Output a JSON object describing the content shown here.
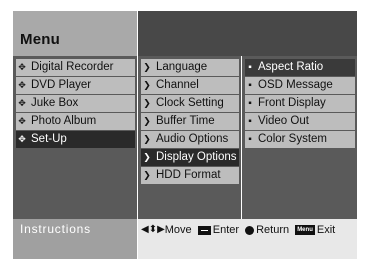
{
  "header": {
    "title": "Menu"
  },
  "columns": {
    "main": [
      {
        "label": "Digital Recorder",
        "selected": false
      },
      {
        "label": "DVD Player",
        "selected": false
      },
      {
        "label": "Juke Box",
        "selected": false
      },
      {
        "label": "Photo Album",
        "selected": false
      },
      {
        "label": "Set-Up",
        "selected": true
      }
    ],
    "setup": [
      {
        "label": "Language",
        "selected": false
      },
      {
        "label": "Channel",
        "selected": false
      },
      {
        "label": "Clock Setting",
        "selected": false
      },
      {
        "label": "Buffer Time",
        "selected": false
      },
      {
        "label": "Audio Options",
        "selected": false
      },
      {
        "label": "Display Options",
        "selected": true
      },
      {
        "label": "HDD Format",
        "selected": false
      }
    ],
    "display": [
      {
        "label": "Aspect Ratio",
        "selected": true
      },
      {
        "label": "OSD Message",
        "selected": false
      },
      {
        "label": "Front Display",
        "selected": false
      },
      {
        "label": "Video Out",
        "selected": false
      },
      {
        "label": "Color System",
        "selected": false
      }
    ]
  },
  "footer": {
    "instructions_label": "Instructions",
    "move_label": "Move",
    "enter_label": "Enter",
    "return_label": "Return",
    "menu_key_label": "Menu",
    "exit_label": "Exit"
  },
  "icons": {
    "main_item": "diamond-cross-icon",
    "submenu_item": "chevron-right-icon",
    "option_item": "bullet-icon",
    "move": "four-way-arrow-icon",
    "enter": "enter-key-icon",
    "return": "return-circle-icon",
    "menu_key": "menu-key-icon"
  }
}
